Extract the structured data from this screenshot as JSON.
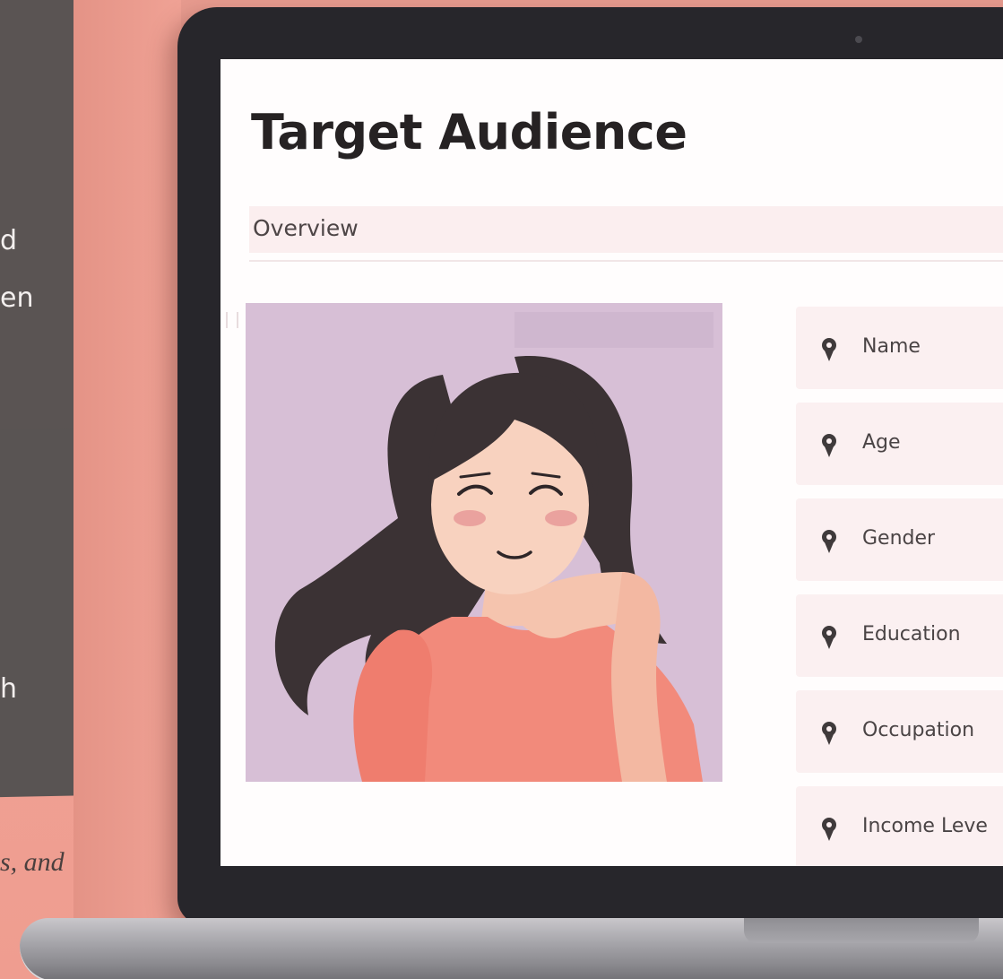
{
  "background": {
    "left_panel_lines": [
      "d",
      "en",
      "h"
    ],
    "italic_caption": "s, and"
  },
  "screen": {
    "title": "Target Audience",
    "section_label": "Overview",
    "fields": [
      {
        "label": "Name",
        "icon": "map-pin-icon"
      },
      {
        "label": "Age",
        "icon": "map-pin-icon"
      },
      {
        "label": "Gender",
        "icon": "map-pin-icon"
      },
      {
        "label": "Education",
        "icon": "map-pin-icon"
      },
      {
        "label": "Occupation",
        "icon": "map-pin-icon"
      },
      {
        "label": "Income Leve",
        "icon": "map-pin-icon"
      }
    ]
  },
  "colors": {
    "background_salmon": "#f0a395",
    "laptop_bezel": "#27262b",
    "field_bg": "#fbf0f1",
    "illustration_bg": "#d7bfd6",
    "shirt": "#f28a7b",
    "hair": "#3b3234"
  }
}
